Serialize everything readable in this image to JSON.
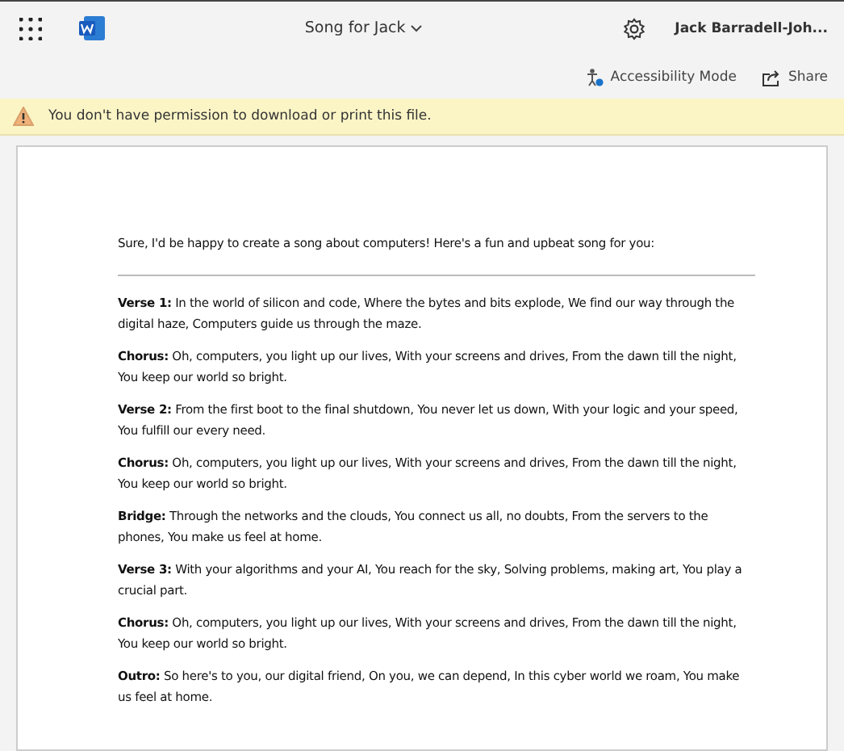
{
  "header": {
    "title": "Song for Jack",
    "user": "Jack Barradell-Joh..."
  },
  "toolbar": {
    "buttons": [
      {
        "kind": "accessibility",
        "label": "Accessibility Mode"
      },
      {
        "kind": "share",
        "label": "Share"
      }
    ]
  },
  "notice": {
    "text": "You don't have permission to download or print this file."
  },
  "document": {
    "intro": "Sure, I'd be happy to create a song about computers! Here's a fun and upbeat song for you:",
    "paragraphs": [
      "**Verse 1:** In the world of silicon and code, Where the bytes and bits explode, We find our way through the digital haze, Computers guide us through the maze.",
      "**Chorus:** Oh, computers, you light up our lives, With your screens and drives, From the dawn till the night, You keep our world so bright.",
      "**Verse 2:** From the first boot to the final shutdown, You never let us down, With your logic and your speed, You fulfill our every need.",
      "**Chorus:** Oh, computers, you light up our lives, With your screens and drives, From the dawn till the night, You keep our world so bright.",
      "**Bridge:** Through the networks and the clouds, You connect us all, no doubts, From the servers to the phones, You make us feel at home.",
      "**Verse 3:** With your algorithms and your AI, You reach for the sky, Solving problems, making art, You play a crucial part.",
      "**Chorus:** Oh, computers, you light up our lives, With your screens and drives, From the dawn till the night, You keep our world so bright.",
      "**Outro:** So here's to you, our digital friend, On you, we can depend, In this cyber world we roam, You make us feel at home."
    ]
  }
}
